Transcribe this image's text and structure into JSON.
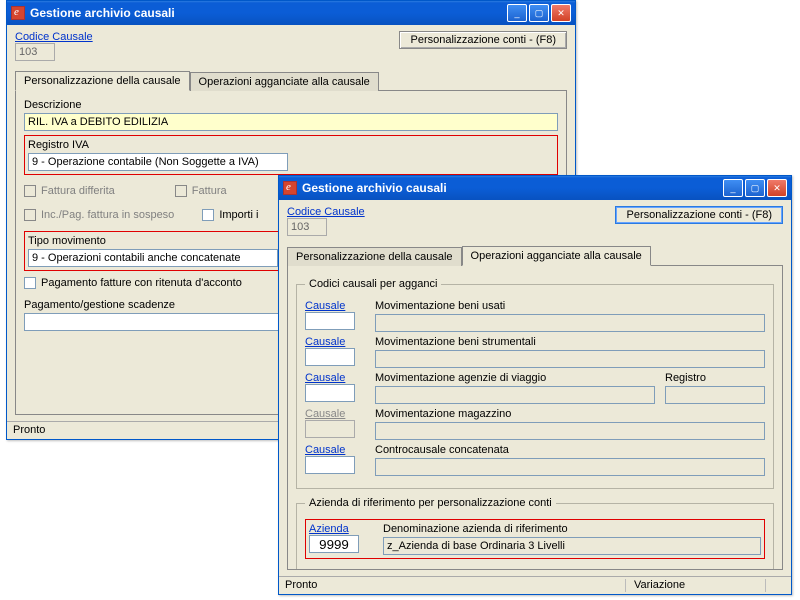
{
  "window1": {
    "title": "Gestione archivio causali",
    "codice_label": "Codice Causale",
    "codice_value": "103",
    "conti_btn": "Personalizzazione conti - (F8)",
    "tabs": {
      "a": "Personalizzazione della causale",
      "b": "Operazioni agganciate alla causale"
    },
    "descrizione_label": "Descrizione",
    "descrizione_value": "RIL. IVA a DEBITO EDILIZIA",
    "registro_label": "Registro IVA",
    "registro_value": "9 - Operazione contabile (Non Soggette a IVA)",
    "chk_fattdiff": "Fattura differita",
    "chk_fattura": "Fattura",
    "chk_incpag": "Inc./Pag. fattura in sospeso",
    "chk_importi": "Importi i",
    "tipo_label": "Tipo movimento",
    "tipo_value": "9 - Operazioni contabili anche concatenate",
    "chk_pagritenuta": "Pagamento fatture con ritenuta d'acconto",
    "pag_gest_label": "Pagamento/gestione scadenze",
    "status_left": "Pronto"
  },
  "window2": {
    "title": "Gestione archivio causali",
    "codice_label": "Codice Causale",
    "codice_value": "103",
    "conti_btn": "Personalizzazione conti - (F8)",
    "tabs": {
      "a": "Personalizzazione della causale",
      "b": "Operazioni agganciate alla causale"
    },
    "hooks_legend": "Codici causali per agganci",
    "hooks": [
      {
        "link": "Causale",
        "label": "Movimentazione beni usati",
        "disabled": false
      },
      {
        "link": "Causale",
        "label": "Movimentazione beni strumentali",
        "disabled": false
      },
      {
        "link": "Causale",
        "label": "Movimentazione agenzie di viaggio",
        "disabled": false,
        "registro": "Registro"
      },
      {
        "link": "Causale",
        "label": "Movimentazione magazzino",
        "disabled": true
      },
      {
        "link": "Causale",
        "label": "Controcausale concatenata",
        "disabled": false
      }
    ],
    "azienda_legend": "Azienda di riferimento per personalizzazione conti",
    "azienda_link": "Azienda",
    "azienda_code": "9999",
    "denom_label": "Denominazione azienda di riferimento",
    "denom_value": "z_Azienda di base Ordinaria 3 Livelli",
    "status_left": "Pronto",
    "status_right": "Variazione"
  }
}
